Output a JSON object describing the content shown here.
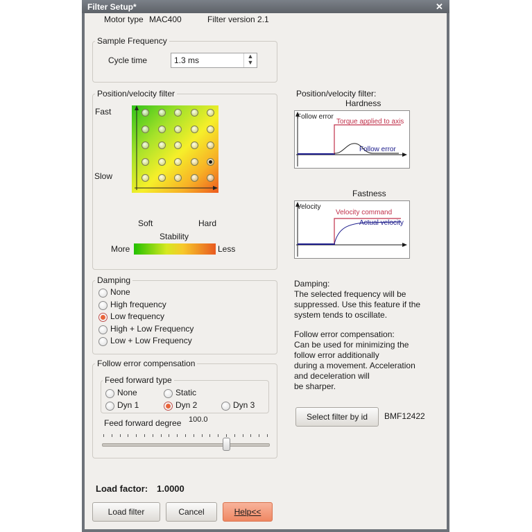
{
  "window": {
    "title": "Filter Setup*",
    "close_label": "✕"
  },
  "header": {
    "motor_type_label": "Motor type",
    "motor_type_value": "MAC400",
    "filter_version": "Filter version 2.1"
  },
  "sample_frequency": {
    "group_label": "Sample Frequency",
    "cycle_time_label": "Cycle time",
    "cycle_time_value": "1.3 ms"
  },
  "posvel": {
    "group_label": "Position/velocity filter",
    "fast_label": "Fast",
    "slow_label": "Slow",
    "soft_label": "Soft",
    "hard_label": "Hard",
    "stability_label": "Stability",
    "more_label": "More",
    "less_label": "Less",
    "grid": {
      "rows": 5,
      "cols": 5,
      "selected_row": 3,
      "selected_col": 4
    }
  },
  "damping": {
    "group_label": "Damping",
    "options": [
      "None",
      "High frequency",
      "Low frequency",
      "High + Low Frequency",
      "Low + Low Frequency"
    ],
    "selected": "Low frequency"
  },
  "follow_error": {
    "group_label": "Follow error compensation",
    "feed_forward_type_label": "Feed forward type",
    "types": [
      "None",
      "Static",
      "Dyn 1",
      "Dyn 2",
      "Dyn 3"
    ],
    "selected": "Dyn 2",
    "degree_label": "Feed forward degree",
    "degree_value": "100.0"
  },
  "load_factor": {
    "label": "Load factor:",
    "value": "1.0000"
  },
  "buttons": {
    "load_filter": "Load filter",
    "cancel": "Cancel",
    "help": "Help<<",
    "select_filter": "Select filter by id"
  },
  "filter_id": "BMF12422",
  "info": {
    "posvel_title": "Position/velocity filter:",
    "hardness_title": "Hardness",
    "hardness_plot": {
      "y_label": "Follow error",
      "torque_label": "Torque applied to axis",
      "follow_label": "Follow error"
    },
    "fastness_title": "Fastness",
    "fastness_plot": {
      "y_label": "Velocity",
      "command_label": "Velocity command",
      "actual_label": "Actual velocity"
    },
    "damping_text": [
      "Damping:",
      "The selected frequency will be",
      "suppressed. Use this feature if the",
      "system tends to oscillate."
    ],
    "follow_text": [
      "Follow error compensation:",
      "Can be used for minimizing the",
      "follow error additionally",
      "during a movement. Acceleration",
      "and deceleration will",
      "be sharper."
    ]
  },
  "colors": {
    "accent": "#e8643a",
    "help_button": "#ef8863",
    "plot_red": "#c0304a",
    "plot_blue": "#1a1a8a",
    "stability_start": "#22c000",
    "stability_end": "#e85a20"
  }
}
